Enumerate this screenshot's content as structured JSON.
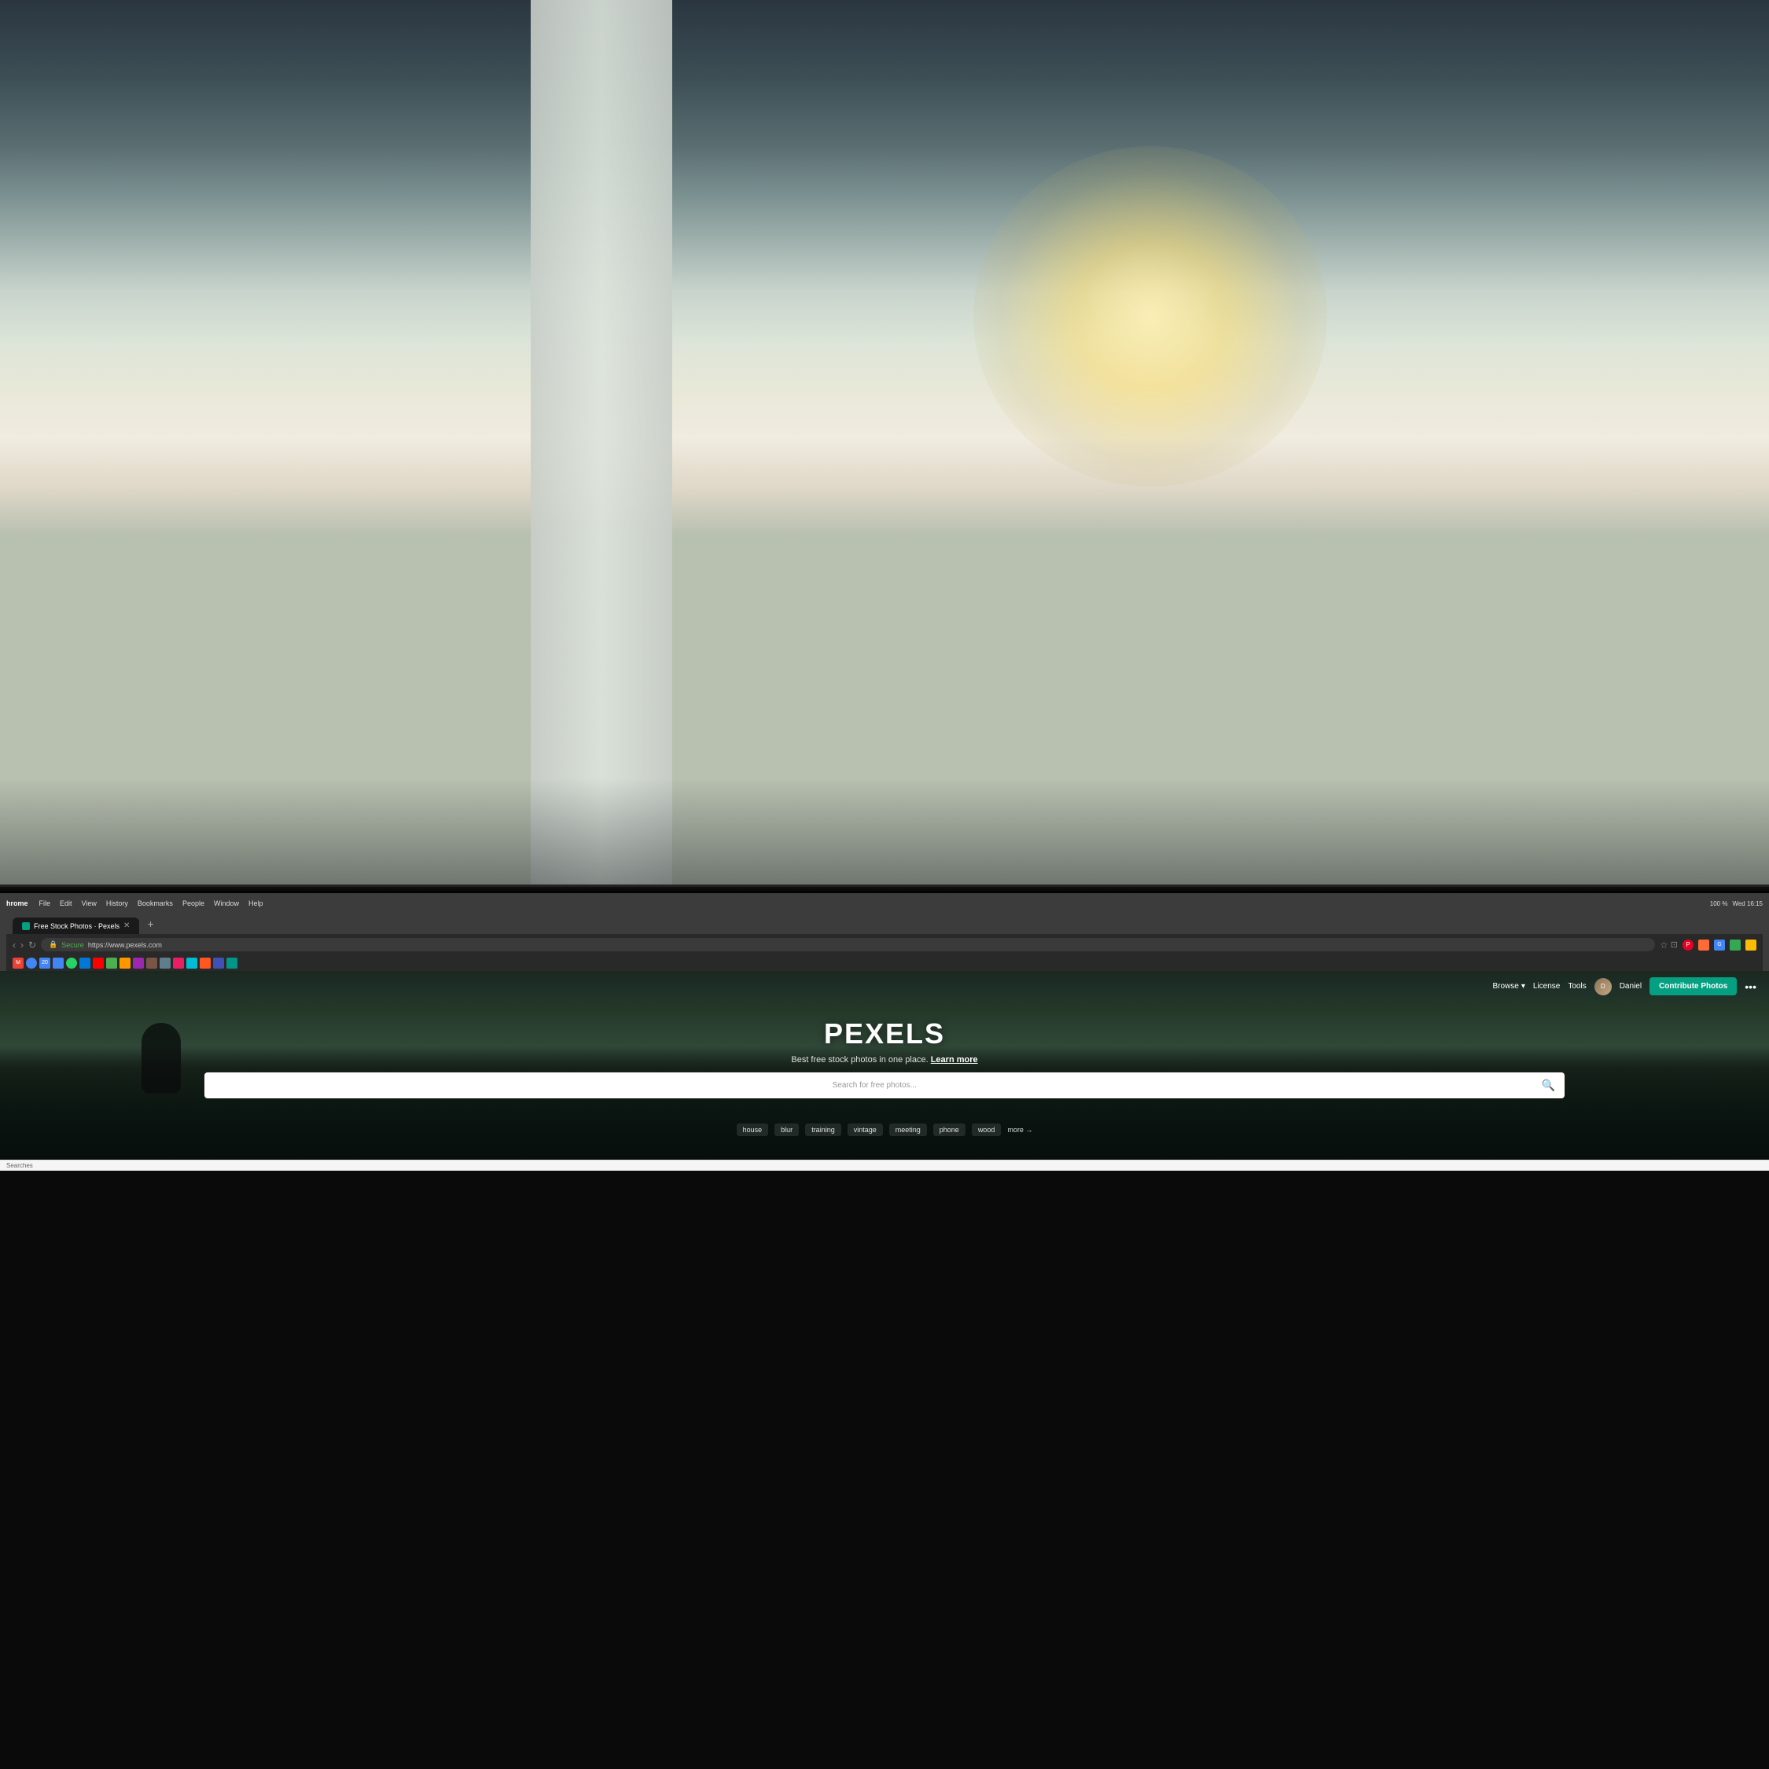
{
  "photo": {
    "description": "Office background photo with natural light"
  },
  "menubar": {
    "app_name": "hrome",
    "items": [
      "File",
      "Edit",
      "View",
      "History",
      "Bookmarks",
      "People",
      "Window",
      "Help"
    ],
    "time": "Wed 16:15",
    "battery": "100 %"
  },
  "browser": {
    "tab": {
      "label": "Free Stock Photos · Pexels",
      "favicon_color": "#05a081"
    },
    "url": {
      "secure_label": "Secure",
      "address": "https://www.pexels.com"
    }
  },
  "pexels_nav": {
    "browse_label": "Browse",
    "license_label": "License",
    "tools_label": "Tools",
    "user_name": "Daniel",
    "contribute_label": "Contribute Photos",
    "more_icon": "•••"
  },
  "pexels_hero": {
    "title": "PEXELS",
    "subtitle": "Best free stock photos in one place.",
    "learn_more": "Learn more",
    "search_placeholder": "Search for free photos...",
    "tags": [
      "house",
      "blur",
      "training",
      "vintage",
      "meeting",
      "phone",
      "wood"
    ],
    "more_tags_label": "more →"
  },
  "status_bar": {
    "text": "Searches"
  }
}
